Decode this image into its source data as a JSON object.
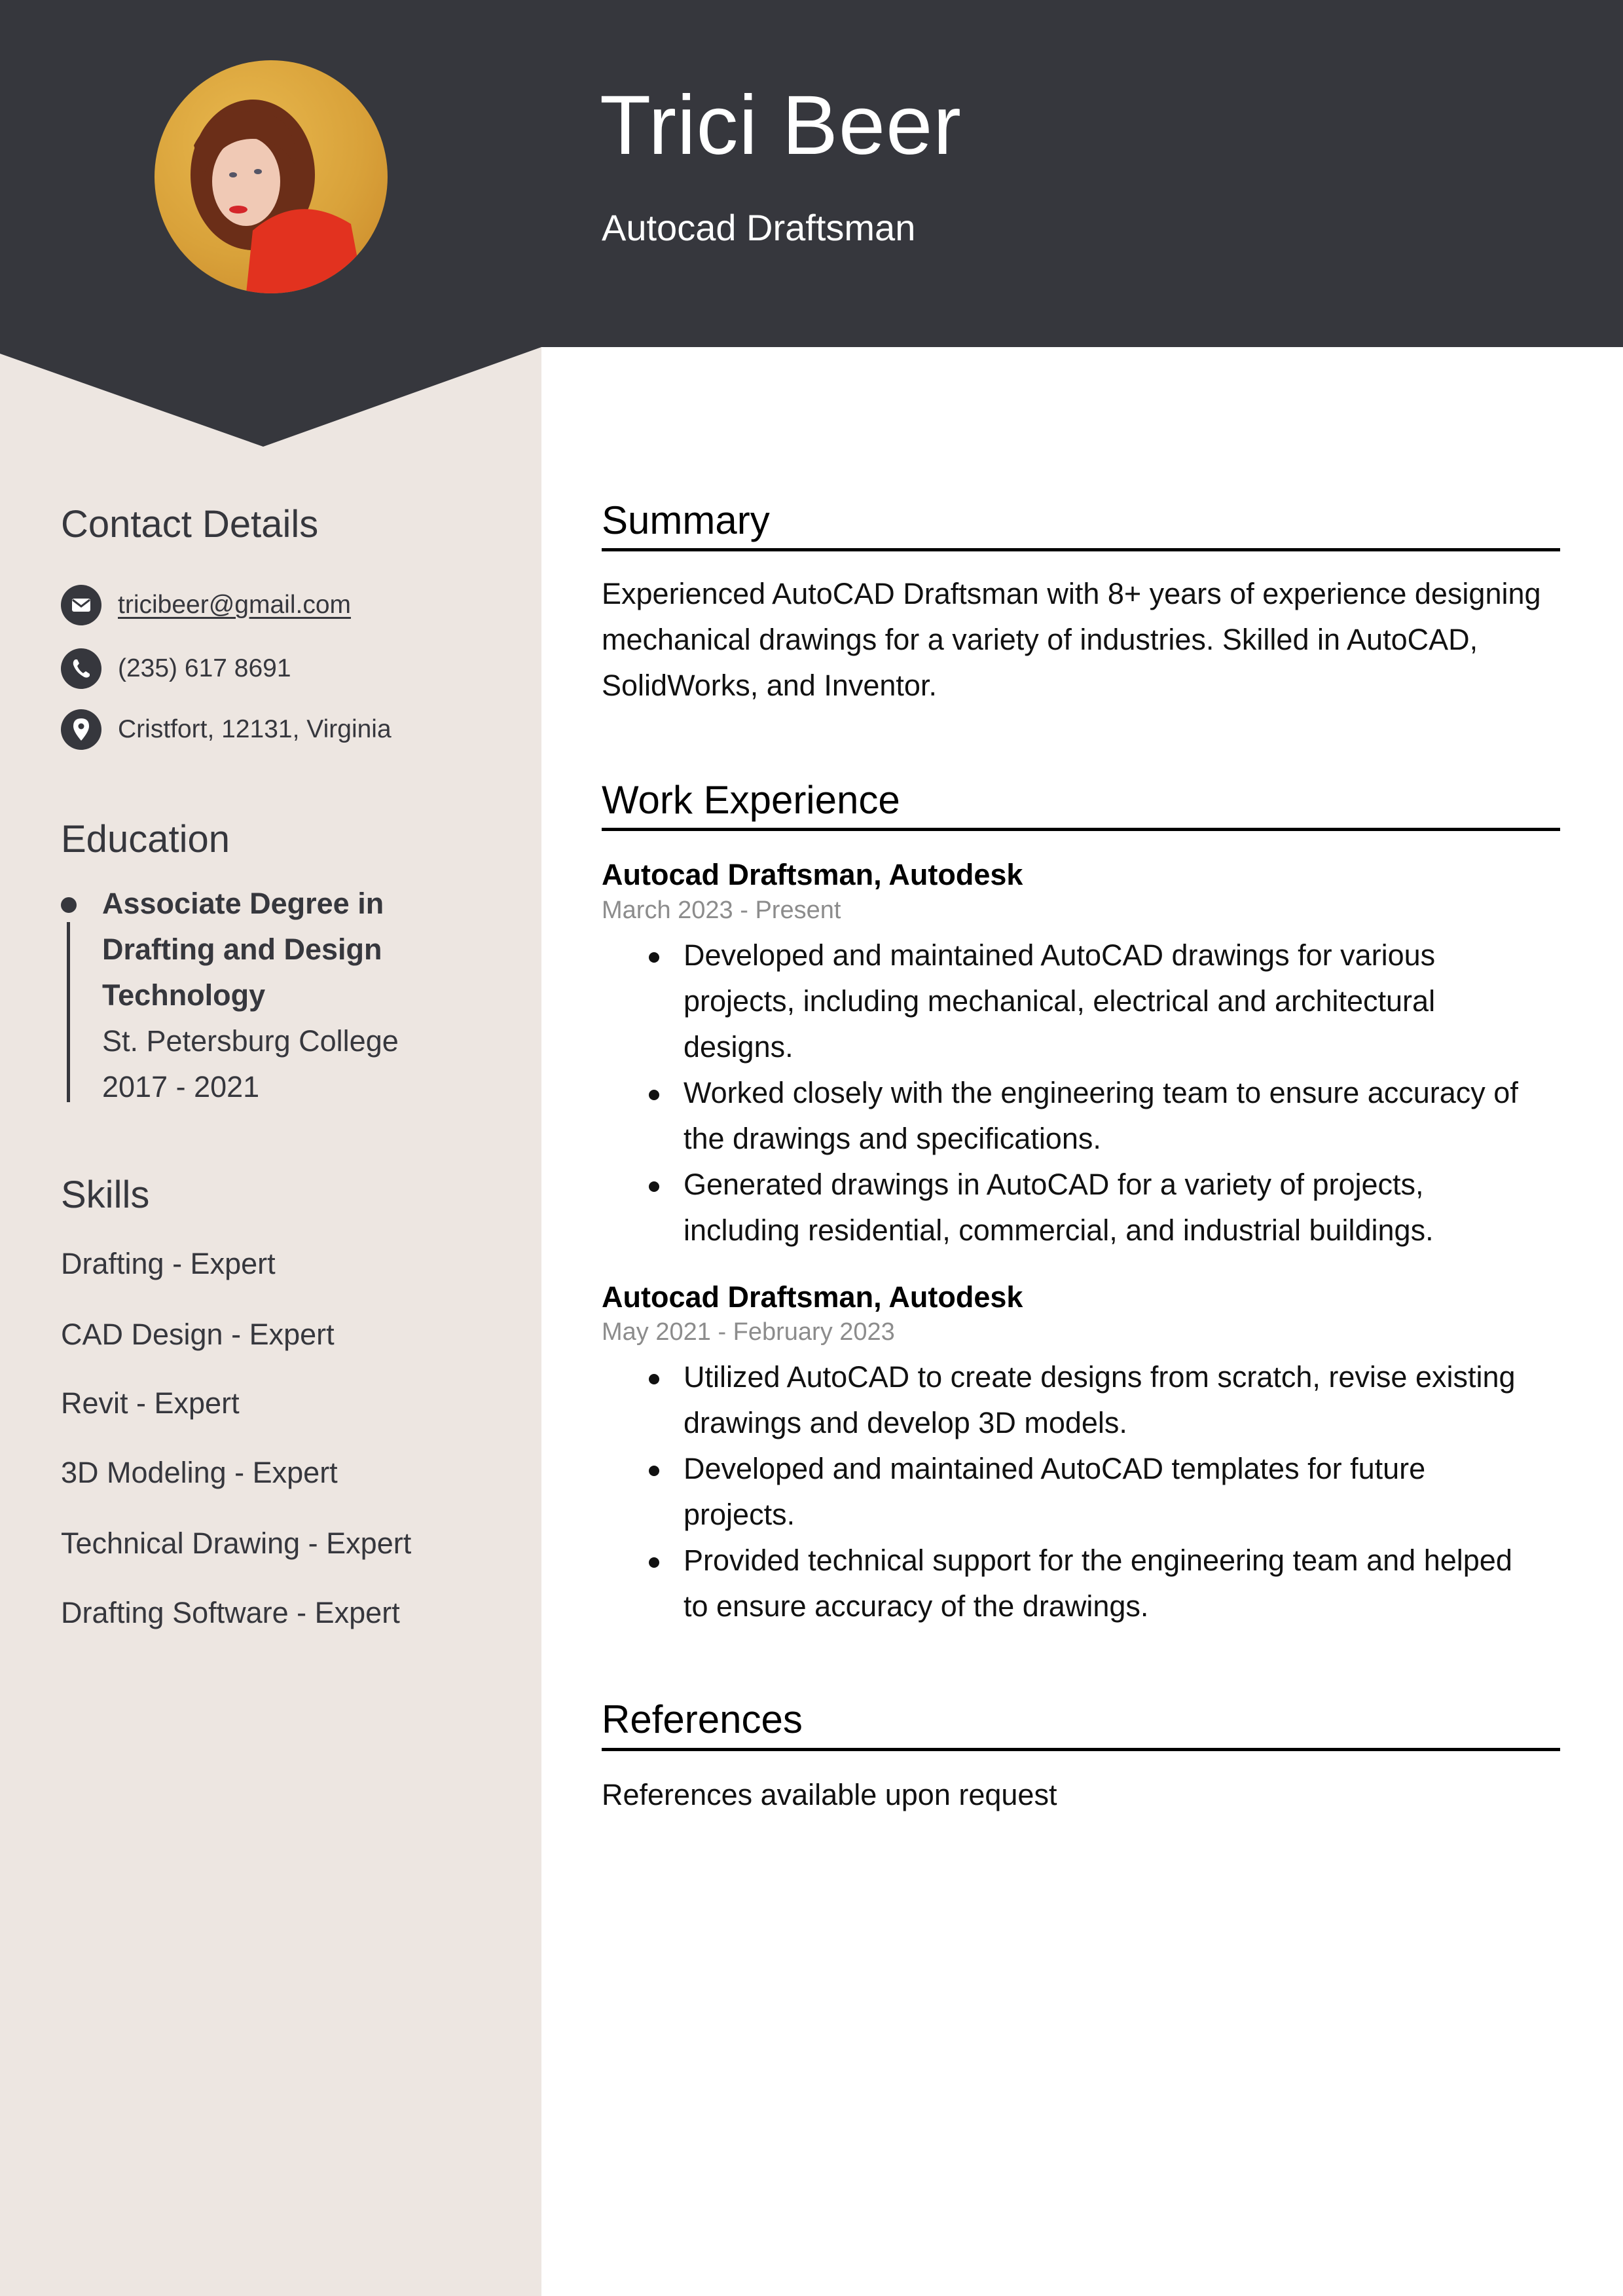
{
  "header": {
    "name": "Trici Beer",
    "title": "Autocad Draftsman",
    "photo_alt": "profile-photo"
  },
  "colors": {
    "dark": "#36373d",
    "sidebar": "#ede6e1",
    "date_gray": "#8c8c8c"
  },
  "sidebar": {
    "contact": {
      "heading": "Contact Details",
      "email": "tricibeer@gmail.com",
      "phone": "(235) 617 8691",
      "address": "Cristfort, 12131, Virginia"
    },
    "education": {
      "heading": "Education",
      "items": [
        {
          "degree_lines": [
            "Associate Degree in",
            "Drafting and Design",
            "Technology"
          ],
          "school": "St. Petersburg College",
          "years": "2017 - 2021"
        }
      ]
    },
    "skills": {
      "heading": "Skills",
      "items": [
        "Drafting - Expert",
        "CAD Design - Expert",
        "Revit - Expert",
        "3D Modeling - Expert",
        "Technical Drawing - Expert",
        "Drafting Software - Expert"
      ]
    }
  },
  "main": {
    "summary": {
      "heading": "Summary",
      "lines": [
        "Experienced AutoCAD Draftsman with 8+ years of experience designing",
        "mechanical drawings for a variety of industries. Skilled in AutoCAD,",
        "SolidWorks, and Inventor."
      ]
    },
    "work": {
      "heading": "Work Experience",
      "jobs": [
        {
          "title": "Autocad Draftsman, Autodesk",
          "dates": "March 2023 - Present",
          "bullets": [
            [
              "Developed and maintained AutoCAD drawings for various",
              "projects, including mechanical, electrical and architectural",
              "designs."
            ],
            [
              "Worked closely with the engineering team to ensure accuracy of",
              "the drawings and specifications."
            ],
            [
              "Generated drawings in AutoCAD for a variety of projects,",
              "including residential, commercial, and industrial buildings."
            ]
          ]
        },
        {
          "title": "Autocad Draftsman, Autodesk",
          "dates": "May 2021 - February 2023",
          "bullets": [
            [
              "Utilized AutoCAD to create designs from scratch, revise existing",
              "drawings and develop 3D models."
            ],
            [
              "Developed and maintained AutoCAD templates for future",
              "projects."
            ],
            [
              "Provided technical support for the engineering team and helped",
              "to ensure accuracy of the drawings."
            ]
          ]
        }
      ]
    },
    "references": {
      "heading": "References",
      "text": "References available upon request"
    }
  }
}
